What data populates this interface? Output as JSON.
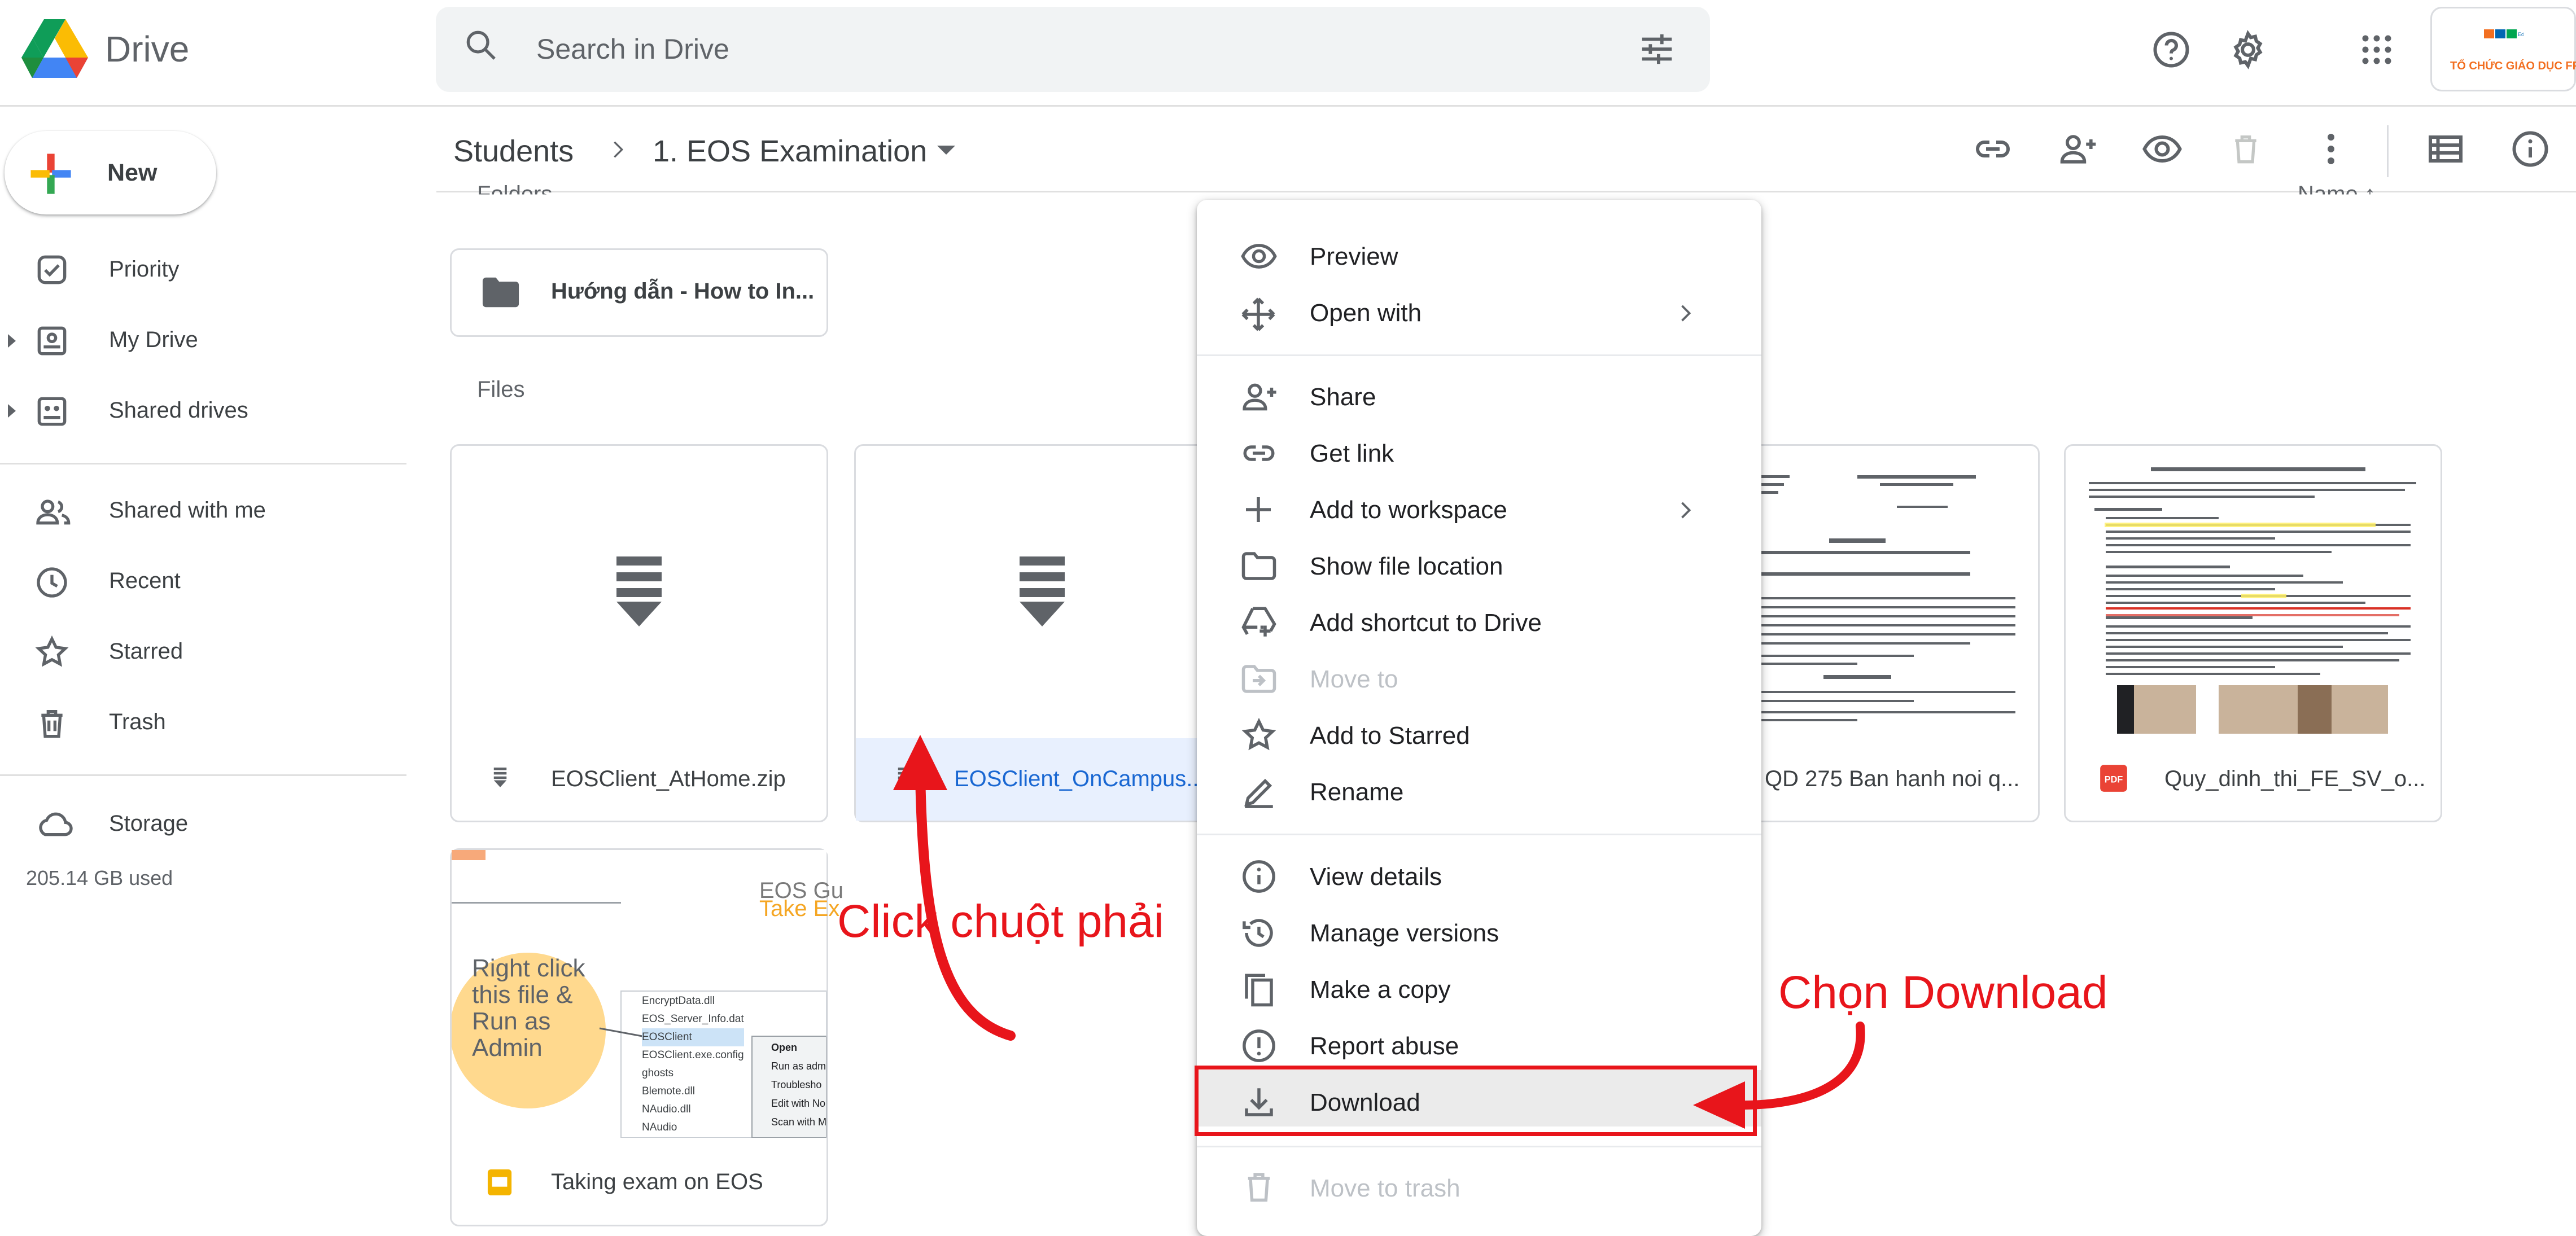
{
  "header": {
    "brand": "Drive",
    "search_placeholder": "Search in Drive",
    "account_text": "TỔ CHỨC GIÁO DỤC FPT"
  },
  "sidebar": {
    "new_label": "New",
    "items": [
      {
        "label": "Priority",
        "icon": "priority-icon"
      },
      {
        "label": "My Drive",
        "icon": "my-drive-icon"
      },
      {
        "label": "Shared drives",
        "icon": "shared-drives-icon"
      },
      {
        "label": "Shared with me",
        "icon": "people-icon"
      },
      {
        "label": "Recent",
        "icon": "clock-icon"
      },
      {
        "label": "Starred",
        "icon": "star-icon"
      },
      {
        "label": "Trash",
        "icon": "trash-icon"
      },
      {
        "label": "Storage",
        "icon": "cloud-icon"
      }
    ],
    "storage_used": "205.14 GB used"
  },
  "breadcrumb": {
    "parent": "Students",
    "current": "1. EOS Examination"
  },
  "content": {
    "folders_label": "Folders",
    "name_sort": "Name   ↑",
    "files_label": "Files",
    "folders": [
      {
        "name": "Hướng dẫn - How to In..."
      }
    ],
    "files": [
      {
        "name": "EOSClient_AtHome.zip"
      },
      {
        "name": "EOSClient_OnCampus..."
      },
      {
        "name": "QD 275 Ban hanh noi q..."
      },
      {
        "name": "Quy_dinh_thi_FE_SV_o..."
      },
      {
        "name": "Taking exam on EOS"
      }
    ],
    "eos_thumb": {
      "title": "EOS Gu",
      "subtitle": "Take Ex",
      "bubble": "Right click this file & Run as Admin",
      "list": [
        "EncryptData.dll",
        "EOS_Server_Info.dat",
        "EOSClient",
        "EOSClient.exe.config",
        "ghosts",
        "Blemote.dll",
        "NAudio.dll",
        "NAudio"
      ],
      "popup": [
        "Open",
        "Run as adm",
        "Troublesho",
        "Edit with No",
        "Scan with M"
      ]
    }
  },
  "context_menu": {
    "items": [
      {
        "label": "Preview",
        "icon": "eye-icon",
        "disabled": false
      },
      {
        "label": "Open with",
        "icon": "move-arrows-icon",
        "disabled": false,
        "submenu": true
      },
      {
        "label": "Share",
        "icon": "person-add-icon",
        "disabled": false
      },
      {
        "label": "Get link",
        "icon": "link-icon",
        "disabled": false
      },
      {
        "label": "Add to workspace",
        "icon": "plus-icon",
        "disabled": false,
        "submenu": true
      },
      {
        "label": "Show file location",
        "icon": "folder-icon",
        "disabled": false
      },
      {
        "label": "Add shortcut to Drive",
        "icon": "drive-shortcut-icon",
        "disabled": false
      },
      {
        "label": "Move to",
        "icon": "move-to-icon",
        "disabled": true
      },
      {
        "label": "Add to Starred",
        "icon": "star-icon",
        "disabled": false
      },
      {
        "label": "Rename",
        "icon": "pencil-icon",
        "disabled": false
      },
      {
        "label": "View details",
        "icon": "info-icon",
        "disabled": false
      },
      {
        "label": "Manage versions",
        "icon": "history-icon",
        "disabled": false
      },
      {
        "label": "Make a copy",
        "icon": "copy-icon",
        "disabled": false
      },
      {
        "label": "Report abuse",
        "icon": "report-icon",
        "disabled": false
      },
      {
        "label": "Download",
        "icon": "download-icon",
        "disabled": false
      },
      {
        "label": "Move to trash",
        "icon": "trash-icon",
        "disabled": true
      }
    ]
  },
  "annotations": {
    "right_click": "Click chuột phải",
    "choose_download": "Chọn Download"
  },
  "colors": {
    "annotation_red": "#e8151b",
    "selected_card": "#e8f0fe",
    "selected_text": "#1967d2"
  }
}
